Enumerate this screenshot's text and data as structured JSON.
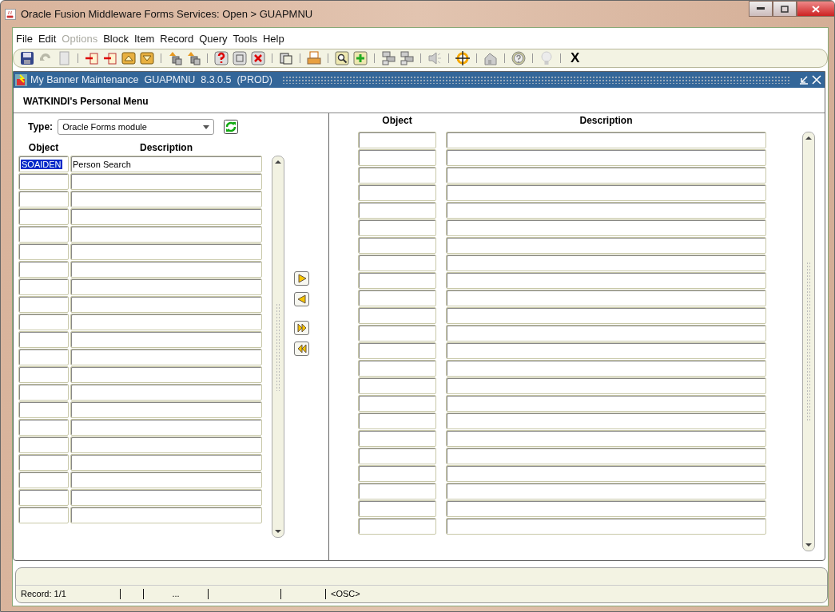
{
  "window": {
    "title": "Oracle Fusion Middleware Forms Services:  Open > GUAPMNU"
  },
  "menu": [
    {
      "label": "File",
      "disabled": false
    },
    {
      "label": "Edit",
      "disabled": false
    },
    {
      "label": "Options",
      "disabled": true
    },
    {
      "label": "Block",
      "disabled": false
    },
    {
      "label": "Item",
      "disabled": false
    },
    {
      "label": "Record",
      "disabled": false
    },
    {
      "label": "Query",
      "disabled": false
    },
    {
      "label": "Tools",
      "disabled": false
    },
    {
      "label": "Help",
      "disabled": false
    }
  ],
  "toolbar": {
    "exit_label": "X"
  },
  "form": {
    "title": "My Banner Maintenance  GUAPMNU  8.3.0.5  (PROD)",
    "heading": "WATKINDI's Personal Menu",
    "type": {
      "label": "Type:",
      "value": "Oracle Forms module"
    },
    "left_list": {
      "columns": [
        "Object",
        "Description"
      ],
      "rows": [
        {
          "object": "SOAIDEN",
          "description": "Person Search",
          "selected": true
        }
      ]
    },
    "right_list": {
      "columns": [
        "Object",
        "Description"
      ]
    }
  },
  "status_bar": {
    "record": "Record: 1/1",
    "field_3": "...",
    "mode": "<OSC>"
  }
}
